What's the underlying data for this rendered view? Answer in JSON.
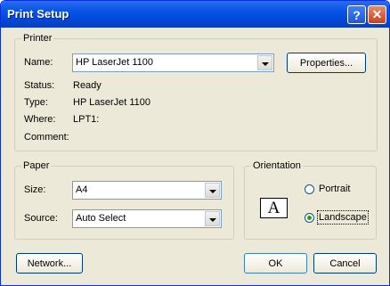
{
  "window": {
    "title": "Print Setup",
    "help_glyph": "?",
    "close_glyph": "✕"
  },
  "printer": {
    "legend": "Printer",
    "name_label": "Name:",
    "name_value": "HP LaserJet 1100",
    "properties_label": "Properties...",
    "status_label": "Status:",
    "status_value": "Ready",
    "type_label": "Type:",
    "type_value": "HP LaserJet 1100",
    "where_label": "Where:",
    "where_value": "LPT1:",
    "comment_label": "Comment:",
    "comment_value": ""
  },
  "paper": {
    "legend": "Paper",
    "size_label": "Size:",
    "size_value": "A4",
    "source_label": "Source:",
    "source_value": "Auto Select"
  },
  "orientation": {
    "legend": "Orientation",
    "icon_glyph": "A",
    "portrait_label": "Portrait",
    "landscape_label": "Landscape",
    "selected": "landscape"
  },
  "buttons": {
    "network": "Network...",
    "ok": "OK",
    "cancel": "Cancel"
  }
}
